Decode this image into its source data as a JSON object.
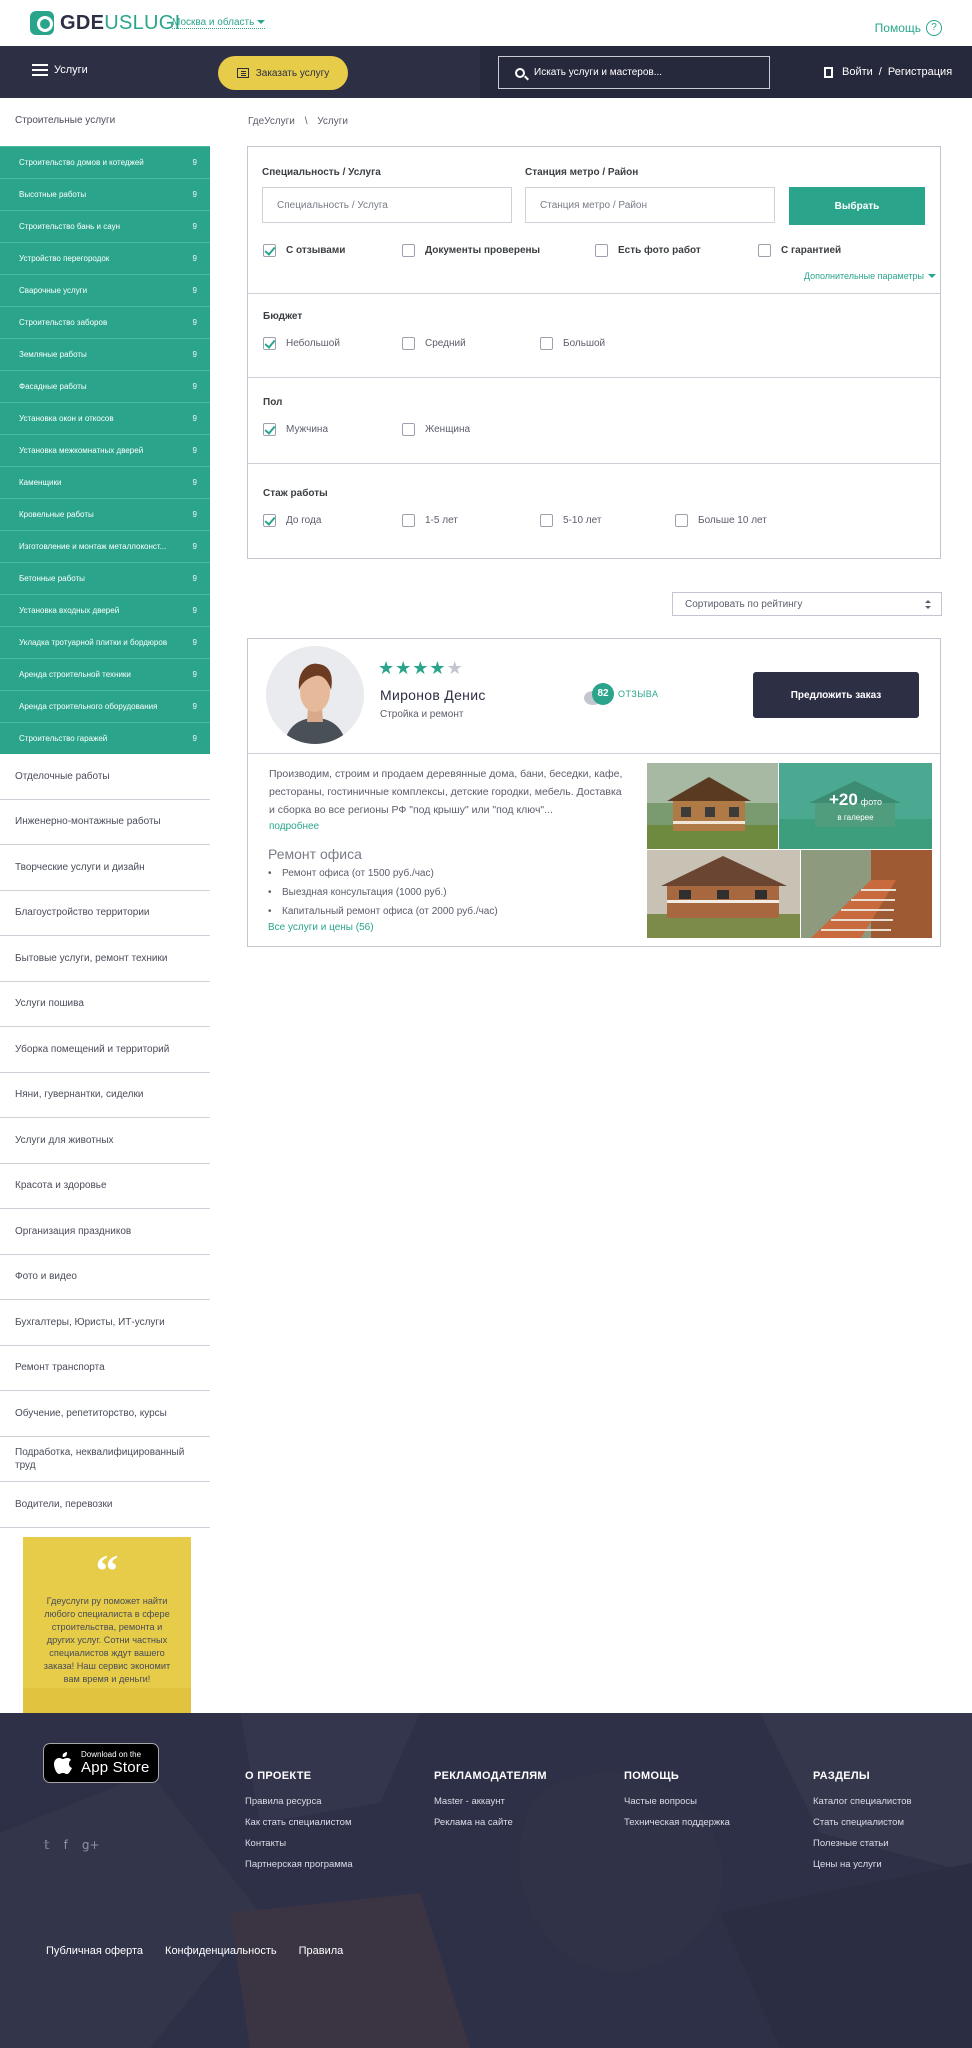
{
  "header": {
    "logo_bold": "GDE",
    "logo_light": "USLUGI",
    "region": "Москва и область",
    "help": "Помощь",
    "help_symbol": "?"
  },
  "nav": {
    "menu_label": "Услуги",
    "order_button": "Заказать услугу",
    "search_placeholder": "Искать услуги и мастеров...",
    "login": "Войти",
    "separator": "/",
    "register": "Регистрация"
  },
  "sidebar": {
    "active_category": "Строительные услуги",
    "sub_items": [
      {
        "label": "Строительство домов  и котеджей",
        "count": "9"
      },
      {
        "label": " Высотные работы",
        "count": "9"
      },
      {
        "label": "Строительство бань и саун",
        "count": "9"
      },
      {
        "label": "Устройство перегородок",
        "count": "9"
      },
      {
        "label": "Сварочные услуги",
        "count": "9"
      },
      {
        "label": "Строительство заборов",
        "count": "9"
      },
      {
        "label": "Земляные работы",
        "count": "9"
      },
      {
        "label": "Фасадные работы",
        "count": "9"
      },
      {
        "label": "Установка окон и откосов",
        "count": "9"
      },
      {
        "label": "Установка межкомнатных дверей",
        "count": "9"
      },
      {
        "label": "Каменщики",
        "count": "9"
      },
      {
        "label": "Кровельные работы",
        "count": "9"
      },
      {
        "label": "Изготовление и монтаж металлоконст...",
        "count": "9"
      },
      {
        "label": "Бетонные работы",
        "count": "9"
      },
      {
        "label": "Установка входных дверей",
        "count": "9"
      },
      {
        "label": "Укладка тротуарной плитки и бордюров",
        "count": "9"
      },
      {
        "label": "Аренда строительной техники",
        "count": "9"
      },
      {
        "label": "Аренда строительного оборудования",
        "count": "9"
      },
      {
        "label": "Строительство гаражей",
        "count": "9"
      }
    ],
    "categories": [
      "Отделочные работы",
      "Инженерно-монтажные работы",
      "Творческие услуги и дизайн",
      "Благоустройство территории",
      "Бытовые услуги, ремонт техники",
      "Услуги пошива",
      "Уборка помещений и территорий",
      "Няни, гувернантки, сиделки",
      "Услуги для животных",
      "Красота и здоровье",
      "Организация праздников",
      "Фото и видео",
      "Бухгалтеры, Юристы, ИТ-услуги",
      "Ремонт транспорта",
      "Обучение, репетиторство, курсы",
      "Подработка, неквалифицированный труд",
      "Водители, перевозки"
    ],
    "quote_mark": "“",
    "quote_text": "Гдеуслуги ру поможет найти любого специалиста в сфере строительства, ремонта  и других услуг. Сотни частных специалистов ждут вашего заказа! Наш сервис экономит вам время  и деньги!"
  },
  "breadcrumbs": {
    "home": "ГдеУслуги",
    "separator": "\\",
    "current": "Услуги"
  },
  "filter": {
    "specialty_label": "Специальность / Услуга",
    "specialty_placeholder": "Специальность / Услуга",
    "metro_label": "Станция метро / Район",
    "metro_placeholder": "Станция метро / Район",
    "submit": "Выбрать",
    "options": [
      {
        "label": "С отзывами",
        "checked": true
      },
      {
        "label": "Документы проверены",
        "checked": false
      },
      {
        "label": "Есть фото работ",
        "checked": false
      },
      {
        "label": "С гарантией",
        "checked": false
      }
    ],
    "more_params": "Дополнительные параметры",
    "budget": {
      "title": "Бюджет",
      "options": [
        {
          "label": "Небольшой",
          "checked": true
        },
        {
          "label": "Средний",
          "checked": false
        },
        {
          "label": "Большой",
          "checked": false
        }
      ]
    },
    "gender": {
      "title": "Пол",
      "options": [
        {
          "label": "Мужчина",
          "checked": true
        },
        {
          "label": "Женщина",
          "checked": false
        }
      ]
    },
    "experience": {
      "title": "Стаж работы",
      "options": [
        {
          "label": "До года",
          "checked": true
        },
        {
          "label": "1-5 лет",
          "checked": false
        },
        {
          "label": "5-10 лет",
          "checked": false
        },
        {
          "label": "Больше 10 лет",
          "checked": false
        }
      ]
    }
  },
  "sort": {
    "selected": "Сортировать по рейтингу"
  },
  "specialist": {
    "rating": 4,
    "rating_max": 5,
    "name": "Миронов Денис",
    "specialty": "Стройка и ремонт",
    "reviews_count": "82",
    "reviews_label": "ОТЗЫВА",
    "offer_button": "Предложить заказ",
    "description": "Производим, строим и продаем деревянные дома, бани, беседки, кафе, рестораны, гостиничные комплексы, детские городки, мебель. Доставка и сборка во все регионы РФ \"под крышу\" или \"под ключ\"...",
    "more": "подробнее",
    "service_title": "Ремонт офиса",
    "services": [
      "Ремонт офиса (от 1500 руб./час)",
      "Выездная консультация (1000 руб.)",
      "Капитальный ремонт офиса (от 2000 руб./час)"
    ],
    "all_services": "Все услуги и цены (56)",
    "gallery_count": "+20",
    "gallery_unit": "фото",
    "gallery_label": "в галерее"
  },
  "footer": {
    "appstore_small": "Download on the",
    "appstore_big": "App Store",
    "social_icons": [
      "twitter-icon",
      "facebook-icon",
      "google-plus-icon"
    ],
    "social_glyphs": [
      "𝕥",
      "f",
      "g+"
    ],
    "columns": [
      {
        "title": "О ПРОЕКТЕ",
        "links": [
          "Правила ресурса",
          "Как стать специалистом",
          "Контакты",
          "Партнерская программа"
        ]
      },
      {
        "title": "РЕКЛАМОДАТЕЛЯМ",
        "links": [
          "Master - аккаунт",
          "Реклама на сайте"
        ]
      },
      {
        "title": "ПОМОЩЬ",
        "links": [
          "Частые вопросы",
          "Техническая поддержка"
        ]
      },
      {
        "title": "РАЗДЕЛЫ",
        "links": [
          "Каталог специалистов",
          "Стать специалистом",
          "Полезные статьи",
          "Цены на услуги"
        ]
      }
    ],
    "bottom_links": [
      "Публичная оферта",
      "Конфиденциальность",
      "Правила"
    ]
  },
  "colors": {
    "accent": "#2aa58c",
    "navy": "#2d2f45",
    "yellow": "#e6cc49"
  }
}
